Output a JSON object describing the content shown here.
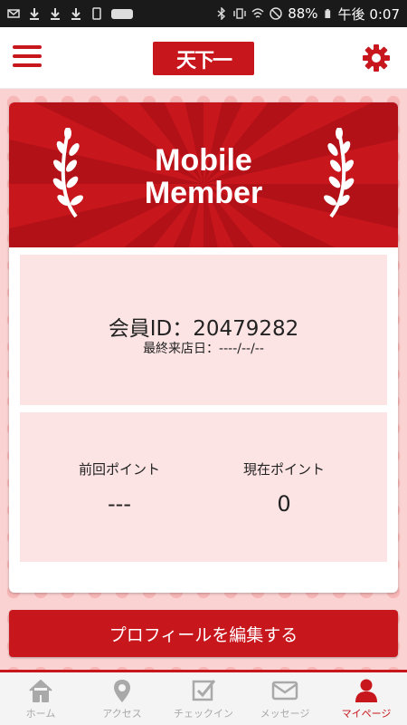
{
  "status_bar": {
    "battery": "88%",
    "time": "午後 0:07"
  },
  "header": {
    "logo_text": "天下一"
  },
  "card": {
    "banner_title_line1": "Mobile",
    "banner_title_line2": "Member",
    "member_id_label": "会員ID：",
    "member_id_value": "20479282",
    "last_visit": "最終来店日：----/--/--",
    "previous_points_label": "前回ポイント",
    "previous_points_value": "---",
    "current_points_label": "現在ポイント",
    "current_points_value": "0"
  },
  "edit_profile_label": "プロフィールを編集する",
  "tabs": [
    {
      "label": "ホーム",
      "icon": "home-icon"
    },
    {
      "label": "アクセス",
      "icon": "map-pin-icon"
    },
    {
      "label": "チェックイン",
      "icon": "checkin-icon"
    },
    {
      "label": "メッセージ",
      "icon": "envelope-icon"
    },
    {
      "label": "マイページ",
      "icon": "user-icon"
    }
  ],
  "colors": {
    "brand_red": "#c8161d",
    "panel_pink": "#fde4e4",
    "background_pink": "#fbd2d2",
    "tab_inactive": "#a9a9a9"
  }
}
